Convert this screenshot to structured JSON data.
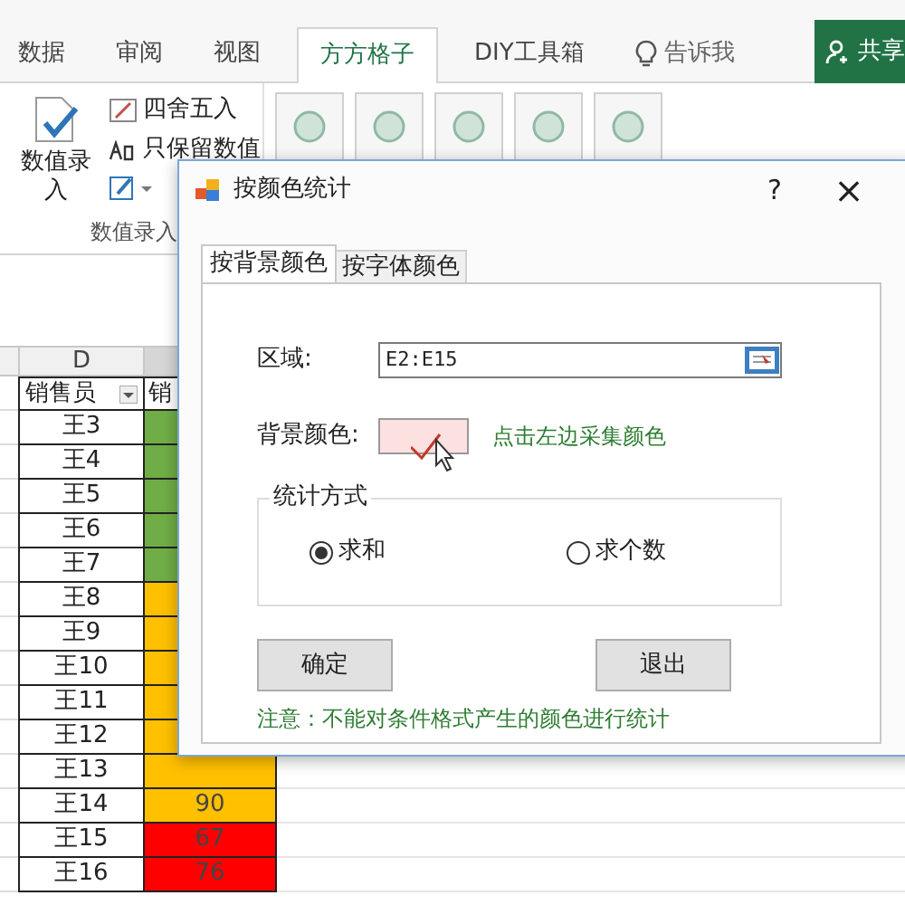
{
  "ribbon": {
    "tabs": [
      {
        "label": "数据",
        "selected": false
      },
      {
        "label": "审阅",
        "selected": false
      },
      {
        "label": "视图",
        "selected": false
      },
      {
        "label": "方方格子",
        "selected": true
      },
      {
        "label": "DIY工具箱",
        "selected": false
      }
    ],
    "tell_me": "告诉我",
    "share_button": "共享",
    "big_button": "数值录入",
    "small_items": [
      "四舍五入",
      "只保留数值"
    ],
    "group_label": "数值录入"
  },
  "sheet": {
    "column_letter": "D",
    "header": "销售员",
    "column_e_header": "销",
    "rows": [
      {
        "name": "王3",
        "value": "",
        "color": "#70ad47"
      },
      {
        "name": "王4",
        "value": "",
        "color": "#70ad47"
      },
      {
        "name": "王5",
        "value": "",
        "color": "#70ad47"
      },
      {
        "name": "王6",
        "value": "",
        "color": "#70ad47"
      },
      {
        "name": "王7",
        "value": "",
        "color": "#70ad47"
      },
      {
        "name": "王8",
        "value": "",
        "color": "#ffc000"
      },
      {
        "name": "王9",
        "value": "",
        "color": "#ffc000"
      },
      {
        "name": "王10",
        "value": "",
        "color": "#ffc000"
      },
      {
        "name": "王11",
        "value": "",
        "color": "#ffc000"
      },
      {
        "name": "王12",
        "value": "",
        "color": "#ffc000"
      },
      {
        "name": "王13",
        "value": "",
        "color": "#ffc000"
      },
      {
        "name": "王14",
        "value": "90",
        "color": "#ffc000"
      },
      {
        "name": "王15",
        "value": "67",
        "color": "#ff0000"
      },
      {
        "name": "王16",
        "value": "76",
        "color": "#ff0000"
      }
    ]
  },
  "dialog": {
    "title": "按颜色统计",
    "help": "?",
    "close": "×",
    "tabs": [
      {
        "label": "按背景颜色",
        "selected": true
      },
      {
        "label": "按字体颜色",
        "selected": false
      }
    ],
    "range_label": "区域:",
    "range_value": "E2:E15",
    "color_label": "背景颜色:",
    "color_hint": "点击左边采集颜色",
    "group_title": "统计方式",
    "options": [
      {
        "label": "求和",
        "selected": true
      },
      {
        "label": "求个数",
        "selected": false
      }
    ],
    "buttons": [
      "确定",
      "退出"
    ],
    "note": "注意：不能对条件格式产生的颜色进行统计"
  }
}
